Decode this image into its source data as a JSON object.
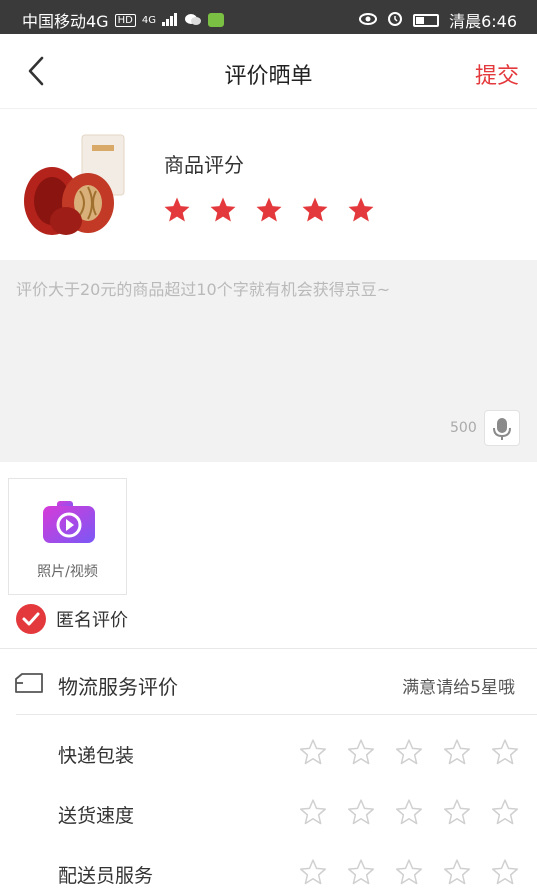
{
  "status_bar": {
    "carrier": "中国移动4G",
    "hd_badge": "HD",
    "signal_badge": "4G",
    "time": "清晨6:46"
  },
  "header": {
    "title": "评价晒单",
    "submit_label": "提交",
    "back_icon": "chevron-left-icon"
  },
  "product": {
    "rating_label": "商品评分",
    "stars": 5,
    "star_color": "#e4393c"
  },
  "review": {
    "placeholder": "评价大于20元的商品超过10个字就有机会获得京豆~",
    "char_limit": "500",
    "mic_icon": "microphone-icon"
  },
  "media": {
    "label": "照片/视频",
    "icon": "camera-video-icon"
  },
  "anonymous": {
    "label": "匿名评价",
    "checked": true
  },
  "logistics": {
    "title": "物流服务评价",
    "hint": "满意请给5星哦",
    "icon": "truck-icon",
    "rows": [
      {
        "label": "快递包装",
        "stars": 0
      },
      {
        "label": "送货速度",
        "stars": 0
      },
      {
        "label": "配送员服务",
        "stars": 0
      }
    ]
  },
  "colors": {
    "accent": "#e4393c",
    "statusbar": "#3a3a3a"
  }
}
